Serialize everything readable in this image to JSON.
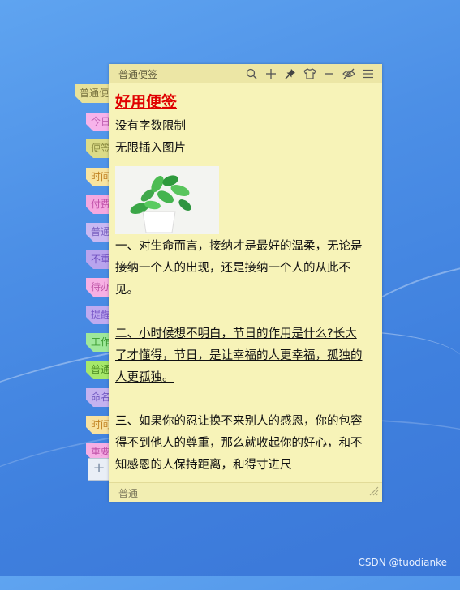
{
  "note": {
    "window_title": "普通便签",
    "toolbar": {
      "search": "search-icon",
      "add": "plus-icon",
      "pin": "pin-icon",
      "skin": "shirt-icon",
      "minimize": "minimize-icon",
      "hide": "eye-off-icon",
      "menu": "menu-icon"
    },
    "heading": "好用便签",
    "lines": [
      "没有字数限制",
      "无限插入图片"
    ],
    "image_alt": "potted-plant",
    "para1": "一、对生命而言，接纳才是最好的温柔，无论是接纳一个人的出现，还是接纳一个人的从此不见。",
    "para2": "二、小时候想不明白，节日的作用是什么?长大了才懂得，节日，是让幸福的人更幸福，孤独的人更孤独。",
    "para3": "三、如果你的忍让换不来别人的感恩，你的包容得不到他人的尊重，那么就收起你的好心，和不知感恩的人保持距离，和得寸进尺",
    "status": "普通",
    "resize": "resize-grip-icon"
  },
  "side_tabs": [
    {
      "label": "普通便签",
      "color": "#e8e29a",
      "text_color": "#7a7440"
    },
    {
      "label": "今日",
      "color": "#f7b3ea",
      "text_color": "#c060b0"
    },
    {
      "label": "便签",
      "color": "#dcdc88",
      "text_color": "#8a8a40"
    },
    {
      "label": "时间",
      "color": "#f8e4a0",
      "text_color": "#c08020"
    },
    {
      "label": "付费",
      "color": "#f4a8e0",
      "text_color": "#c050a8"
    },
    {
      "label": "普通",
      "color": "#c9b8f2",
      "text_color": "#7a60c0"
    },
    {
      "label": "不重",
      "color": "#b9a4ee",
      "text_color": "#7050c0"
    },
    {
      "label": "待办",
      "color": "#f7b0e4",
      "text_color": "#c058a8"
    },
    {
      "label": "提醒",
      "color": "#bfaaf0",
      "text_color": "#7a58c8"
    },
    {
      "label": "工作",
      "color": "#9fe89a",
      "text_color": "#3a9a30"
    },
    {
      "label": "普通",
      "color": "#a6e86a",
      "text_color": "#4a8a20"
    },
    {
      "label": "命名",
      "color": "#c4b2f0",
      "text_color": "#7058c0"
    },
    {
      "label": "时间",
      "color": "#f8e2a0",
      "text_color": "#c08020"
    },
    {
      "label": "重要",
      "color": "#f6aee4",
      "text_color": "#c050a8"
    }
  ],
  "add_tab_label": "+",
  "watermark": "CSDN @tuodianke"
}
